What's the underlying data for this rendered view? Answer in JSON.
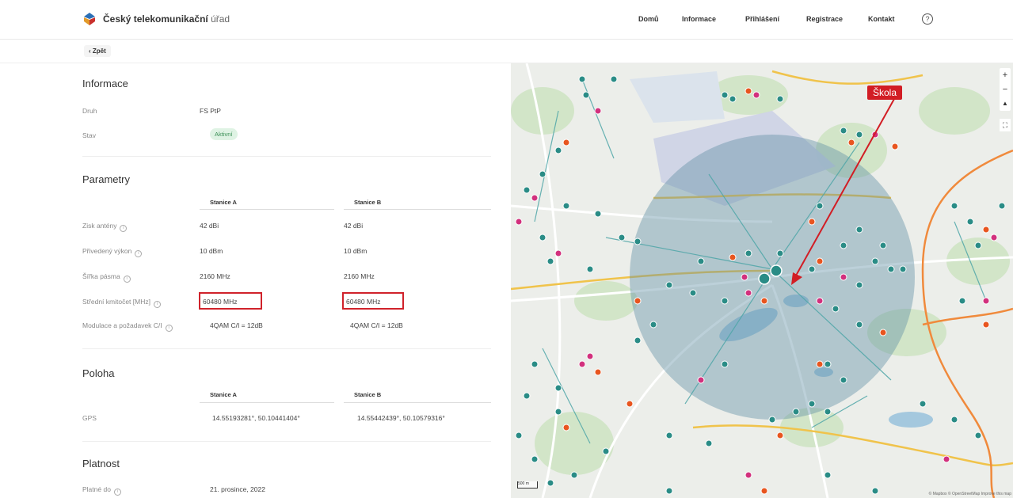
{
  "header": {
    "logo_bold": "Český telekomunikační",
    "logo_thin": "úřad",
    "nav": [
      "Domů",
      "Informace",
      "Přihlášení",
      "Registrace",
      "Kontakt"
    ],
    "help": "?"
  },
  "back_label": "‹ Zpět",
  "info": {
    "title": "Informace",
    "druh_label": "Druh",
    "druh_value": "FS PtP",
    "stav_label": "Stav",
    "stav_value": "Aktivní"
  },
  "params": {
    "title": "Parametry",
    "col_a": "Stanice A",
    "col_b": "Stanice B",
    "rows": [
      {
        "label": "Zisk antény",
        "a": "42 dBi",
        "b": "42 dBi"
      },
      {
        "label": "Přivedený výkon",
        "a": "10 dBm",
        "b": "10 dBm"
      },
      {
        "label": "Šířka pásma",
        "a": "2160 MHz",
        "b": "2160 MHz"
      },
      {
        "label": "Střední kmitočet [MHz]",
        "a": "60480 MHz",
        "b": "60480 MHz"
      },
      {
        "label": "Modulace a požadavek C/I",
        "a": "4QAM C/I = 12dB",
        "b": "4QAM C/I = 12dB"
      }
    ]
  },
  "location": {
    "title": "Poloha",
    "col_a": "Stanice A",
    "col_b": "Stanice B",
    "gps_label": "GPS",
    "gps_a": "14.55193281°, 50.10441404°",
    "gps_b": "14.55442439°, 50.10579316°"
  },
  "validity": {
    "title": "Platnost",
    "label": "Platné do",
    "value": "21. prosince, 2022"
  },
  "map": {
    "annotation": "Škola",
    "zoom_in": "+",
    "zoom_out": "−",
    "compass": "▲",
    "fullscreen": "⛶",
    "scale": "500 m",
    "attribution": "© Mapbox © OpenStreetMap Improve this map",
    "colors": {
      "teal": "#2a8c86",
      "magenta": "#d2307d",
      "orange": "#e8551f",
      "circle": "#5f8fa5"
    }
  }
}
